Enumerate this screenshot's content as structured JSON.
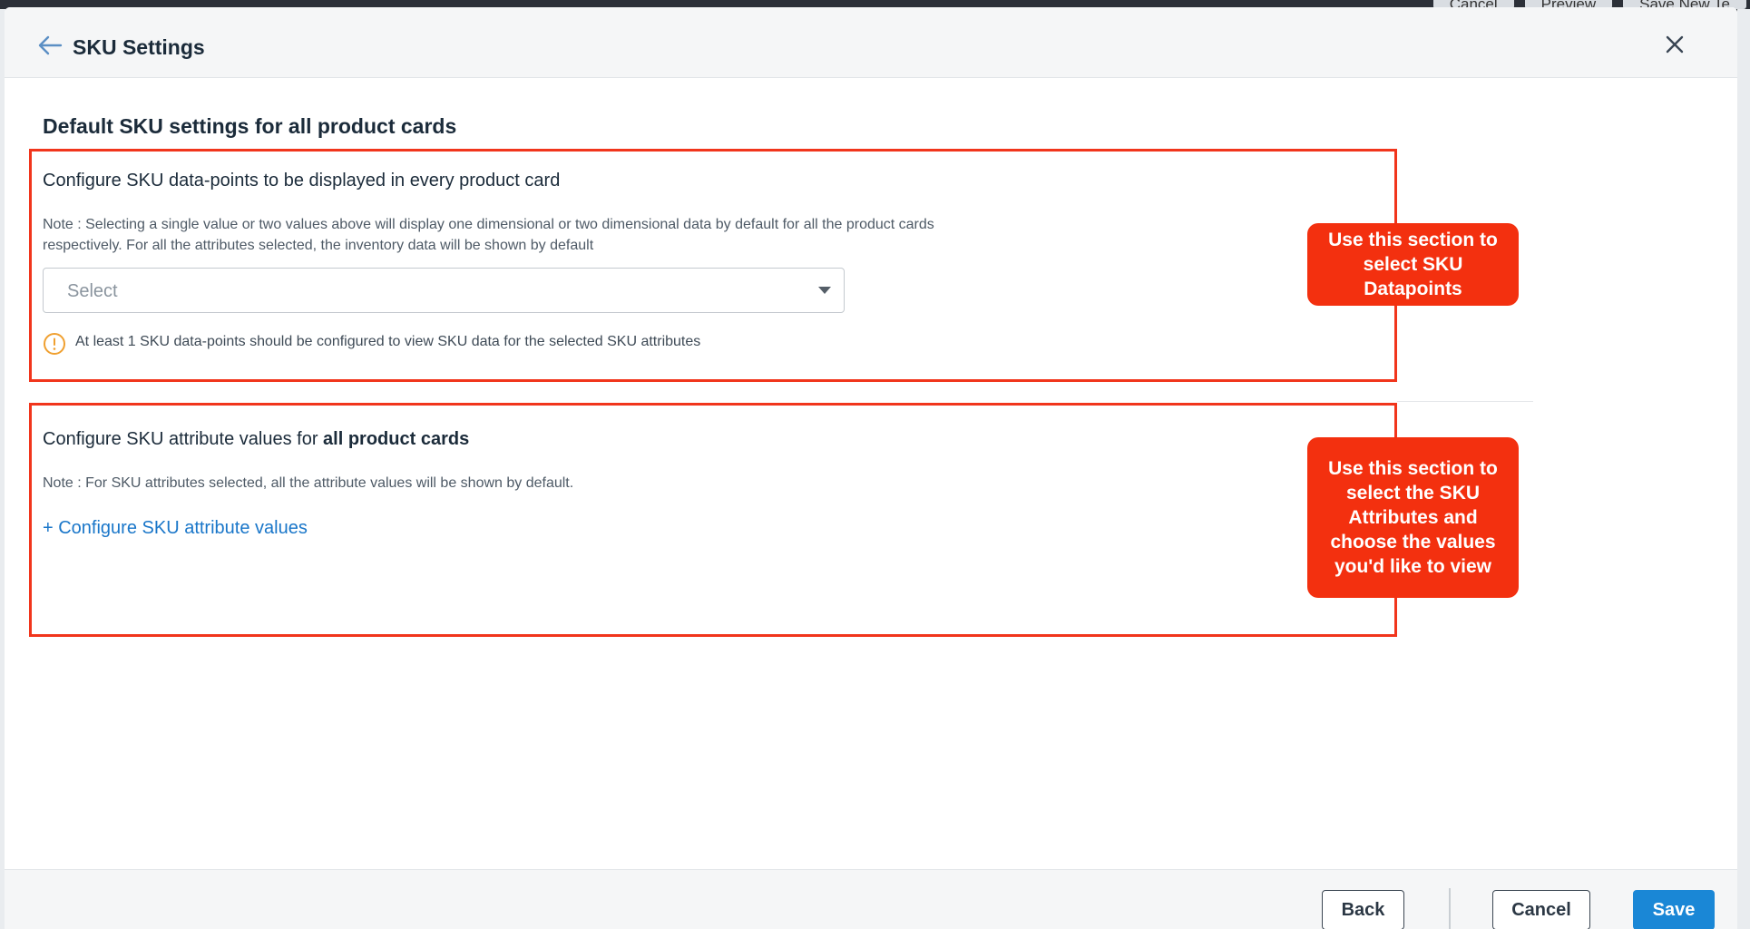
{
  "background": {
    "top_buttons": [
      "Cancel",
      "Preview",
      "Save New Te"
    ]
  },
  "header": {
    "title": "SKU Settings",
    "back_icon": "arrow-left-icon",
    "close_icon": "close-icon"
  },
  "page": {
    "heading": "Default SKU settings for all product cards"
  },
  "datapoints_section": {
    "title": "Configure SKU data-points to be displayed in every product card",
    "note_line1": "Note : Selecting a single value or two values above will display one dimensional or two dimensional data by default for all the product cards",
    "note_line2": "respectively. For all the attributes selected, the inventory data will be shown by default",
    "select_placeholder": "Select",
    "warning_text": "At least 1 SKU data-points should be configured to view SKU data for the selected SKU attributes",
    "warning_icon": "warning-circle-icon"
  },
  "attributes_section": {
    "title_prefix": "Configure SKU attribute values for ",
    "title_bold": "all product cards",
    "note": "Note : For SKU attributes selected, all the attribute values will be shown by default.",
    "configure_link": "+ Configure SKU attribute values"
  },
  "callouts": {
    "datapoints": "Use this section to select SKU Datapoints",
    "attributes": "Use this section to select the SKU Attributes and choose the values you'd like to view"
  },
  "footer": {
    "back_label": "Back",
    "cancel_label": "Cancel",
    "save_label": "Save"
  },
  "colors": {
    "accent": "#1a87d6",
    "annotation_red": "#f3300f",
    "link": "#1976c9",
    "warning": "#f0a030"
  }
}
